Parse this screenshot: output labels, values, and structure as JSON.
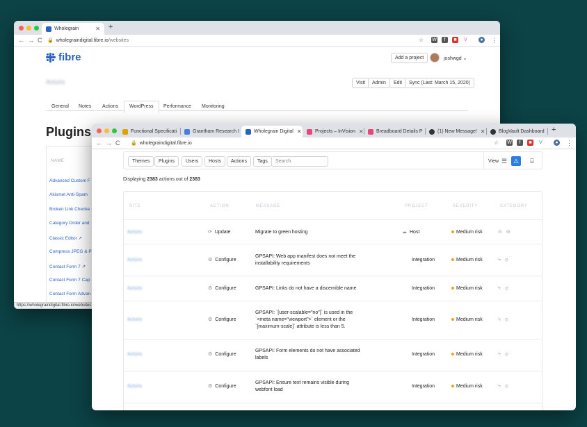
{
  "back_window": {
    "tabs": [
      {
        "title": "Wholegrain"
      }
    ],
    "url": {
      "host": "wholegraindigital.fibre.io",
      "path": "/websites"
    },
    "brand": "fibre",
    "header": {
      "add_project": "Add a project",
      "username": "joshwgd"
    },
    "project_name": "Acturis",
    "actions": {
      "visit": "Visit",
      "admin": "Admin",
      "edit": "Edit",
      "sync": "Sync (Last: March 15, 2020)"
    },
    "project_tabs": [
      "General",
      "Notes",
      "Actions",
      "WordPress",
      "Performance",
      "Monitoring"
    ],
    "selected_tab": "WordPress",
    "heading": "Plugins",
    "list_header": "NAME",
    "plugins": [
      "Advanced Custom F",
      "Akismet Anti-Spam",
      "Broken Link Checke",
      "Category Order and",
      "Classic Editor ↗",
      "Compress JPEG & P",
      "Contact Form 7 ↗",
      "Contact Form 7 Cap",
      "Contact Form Advan"
    ],
    "status_url": "https://wholegraindigital.fibre.io/websites"
  },
  "front_window": {
    "tabs": [
      {
        "title": "Functional Specificati",
        "color": "#d9a400"
      },
      {
        "title": "Grantham Research I",
        "color": "#4a7ce8"
      },
      {
        "title": "Wholegrain Digital",
        "color": "#2a62c4"
      },
      {
        "title": "Projects – InVision",
        "color": "#e8457a"
      },
      {
        "title": "Breadboard Details P",
        "color": "#e8457a"
      },
      {
        "title": "(1) New Message!",
        "color": "#333333"
      },
      {
        "title": "BlogVault Dashboard",
        "color": "#333333"
      }
    ],
    "active_tab": "Wholegrain Digital",
    "url": {
      "host": "wholegraindigital.fibre.io"
    },
    "filters": [
      "Themes",
      "Plugins",
      "Users",
      "Hosts",
      "Actions",
      "Tags"
    ],
    "search_placeholder": "Search",
    "view_label": "View",
    "displaying": {
      "prefix": "Displaying",
      "shown": "2383",
      "middle": "actions out of",
      "total": "2383"
    },
    "columns": [
      "SITE",
      "ACTION",
      "MESSAGE",
      "PROJECT",
      "SEVERITY",
      "CATEGORY"
    ],
    "rows": [
      {
        "site": "Acturis",
        "action": "Update",
        "action_icon": "⟳",
        "message": "Migrate to green hosting",
        "project": "Host",
        "project_icon": "☁",
        "severity": "Medium risk",
        "category": "⊙ ⊝"
      },
      {
        "site": "Acturis",
        "action": "Configure",
        "action_icon": "⚙",
        "message": "GPSAPI: Web app manifest does not meet the installability requirements",
        "project": "Integration",
        "project_icon": "",
        "severity": "Medium risk",
        "category": "⍀ ⊘"
      },
      {
        "site": "Acturis",
        "action": "Configure",
        "action_icon": "⚙",
        "message": "GPSAPI: Links do not have a discernible name",
        "project": "Integration",
        "project_icon": "",
        "severity": "Medium risk",
        "category": "⍀ ⊘"
      },
      {
        "site": "Acturis",
        "action": "Configure",
        "action_icon": "⚙",
        "message": "GPSAPI: `[user-scalable=\"no\"]` is used in the `<meta name=\"viewport\">` element or the `[maximum-scale]` attribute is less than 5.",
        "project": "Integration",
        "project_icon": "",
        "severity": "Medium risk",
        "category": "⍀ ⊘"
      },
      {
        "site": "Acturis",
        "action": "Configure",
        "action_icon": "⚙",
        "message": "GPSAPI: Form elements do not have associated labels",
        "project": "Integration",
        "project_icon": "",
        "severity": "Medium risk",
        "category": "⍀ ⊘"
      },
      {
        "site": "Acturis",
        "action": "Configure",
        "action_icon": "⚙",
        "message": "GPSAPI: Ensure text remains visible during webfont load",
        "project": "Integration",
        "project_icon": "",
        "severity": "Medium risk",
        "category": "⍀ ⊘"
      }
    ]
  },
  "colors": {
    "background": "#0c4346",
    "brand": "#2a62c4",
    "severity_medium": "#e8a317",
    "view_active": "#2d7de0"
  }
}
